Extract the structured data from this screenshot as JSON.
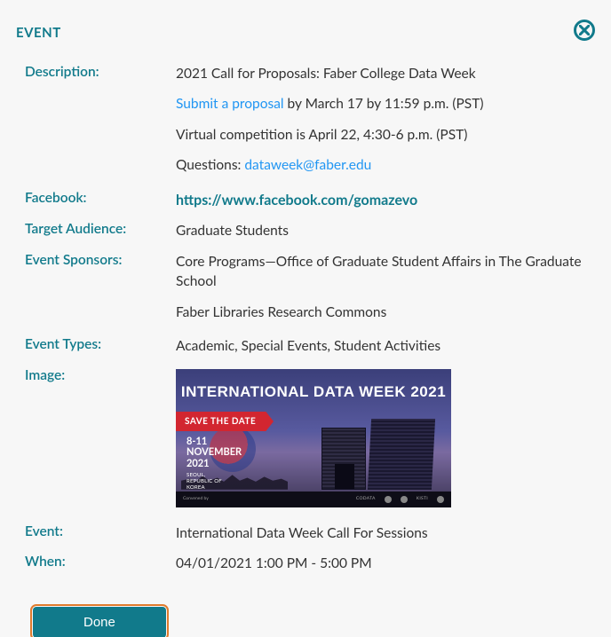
{
  "header": {
    "title": "EVENT"
  },
  "fields": {
    "description_label": "Description:",
    "description": {
      "line1": "2021 Call for Proposals: Faber College Data Week",
      "submit_link": "Submit a proposal",
      "submit_tail": " by March 17 by 11:59 p.m. (PST)",
      "line3": "Virtual competition is April 22, 4:30-6 p.m. (PST)",
      "q_prefix": "Questions: ",
      "q_email": "dataweek@faber.edu"
    },
    "facebook_label": "Facebook:",
    "facebook_url": "https://www.facebook.com/gomazevo",
    "audience_label": "Target Audience:",
    "audience_value": "Graduate Students",
    "sponsors_label": "Event Sponsors:",
    "sponsor1": "Core Programs—Office of Graduate Student Affairs in The Graduate School",
    "sponsor2": "Faber Libraries Research Commons",
    "types_label": "Event Types:",
    "types_value": "Academic, Special Events, Student Activities",
    "image_label": "Image:",
    "event_label": "Event:",
    "event_value": "International Data Week Call For Sessions",
    "when_label": "When:",
    "when_value": "04/01/2021  1:00 PM - 5:00 PM"
  },
  "banner": {
    "title": "INTERNATIONAL DATA WEEK 2021",
    "ribbon": "SAVE THE DATE",
    "date1": "8-11",
    "date2": "NOVEMBER",
    "date3": "2021",
    "loc1": "SEOUL,",
    "loc2": "REPUBLIC OF",
    "loc3": "KOREA"
  },
  "buttons": {
    "done": "Done"
  }
}
